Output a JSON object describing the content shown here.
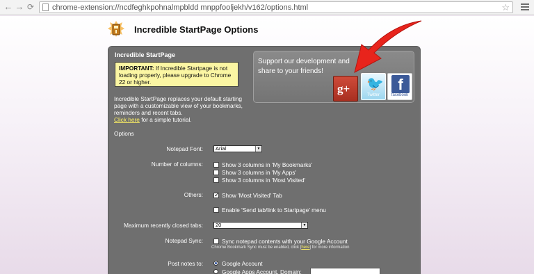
{
  "browser": {
    "url": "chrome-extension://ncdfeghkpohnalmpbldd mnppfooljekh/v162/options.html",
    "back_icon": "back-arrow-icon",
    "forward_icon": "forward-arrow-icon",
    "reload_icon": "reload-icon",
    "bookmark_icon": "star-icon",
    "menu_icon": "menu-icon"
  },
  "header": {
    "title": "Incredible StartPage Options"
  },
  "panel": {
    "heading": "Incredible StartPage",
    "notice_strong": "IMPORTANT:",
    "notice_text": " If Incredible Startpage is not loading properly, please upgrade to Chrome 22 or higher.",
    "description": "Incredible StartPage replaces your default starting page with a customizable view of your bookmarks, reminders and recent tabs.",
    "tutorial_link": "Click here",
    "tutorial_rest": " for a simple tutorial.",
    "options_heading": "Options"
  },
  "share": {
    "text": "Support our development and share to your friends!",
    "gplus_label": "g+",
    "twitter_label": "Twitter",
    "facebook_label": "facebook"
  },
  "options": {
    "notepad_font_label": "Notepad Font:",
    "notepad_font_value": "Arial",
    "columns_label": "Number of columns:",
    "columns": [
      {
        "label": "Show 3 columns in 'My Bookmarks'",
        "checked": false
      },
      {
        "label": "Show 3 columns in 'My Apps'",
        "checked": false
      },
      {
        "label": "Show 3 columns in 'Most Visited'",
        "checked": false
      }
    ],
    "others_label": "Others:",
    "most_visited_tab": {
      "label": "Show 'Most Visited' Tab",
      "checked": true
    },
    "send_tab": {
      "label": "Enable 'Send tab/link to Startpage' menu",
      "checked": false
    },
    "max_closed_tabs_label": "Maximum recently closed tabs:",
    "max_closed_tabs_value": "20",
    "notepad_sync_label": "Notepad Sync:",
    "notepad_sync": {
      "label": "Sync notepad contents with your Google Account",
      "checked": false
    },
    "sync_note_pre": "Chrome Bookmark Sync must be enabled, click [",
    "sync_note_link": "here",
    "sync_note_post": "] for more information",
    "post_notes_label": "Post notes to:",
    "post_notes_google": "Google Account",
    "post_notes_apps": "Google Apps Account, Domain:"
  }
}
